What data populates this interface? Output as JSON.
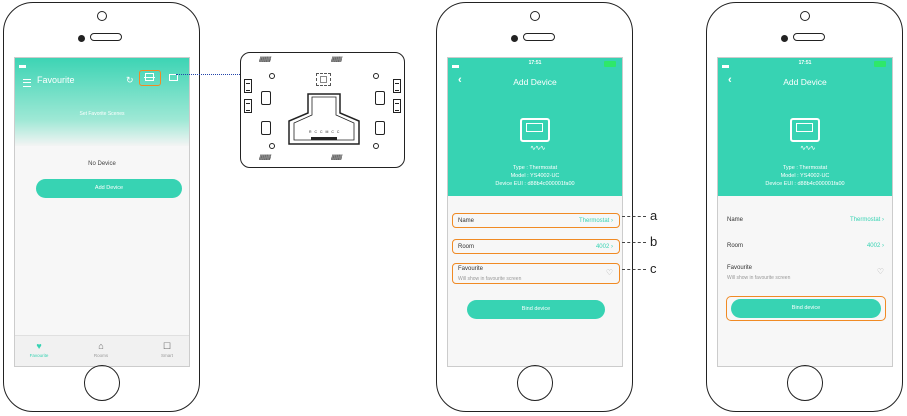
{
  "accent_color": "#37d3b3",
  "highlight_color": "#f08a24",
  "phone1": {
    "header_title": "Favourite",
    "scenes_text": "Set Favorite Scenes",
    "empty_text": "No Device",
    "add_button": "Add Device",
    "tabs": [
      {
        "label": "Favourite",
        "icon": "heart-icon"
      },
      {
        "label": "Rooms",
        "icon": "home-icon"
      },
      {
        "label": "Smart",
        "icon": "monitor-icon"
      }
    ]
  },
  "phone2": {
    "status_time": "17:51",
    "title": "Add Device",
    "type_line": "Type : Thermostat",
    "model_line": "Model : YS4002-UC",
    "eui_line": "Device EUI : d88b4c000001fa00",
    "name_label": "Name",
    "name_value": "Thermostat",
    "room_label": "Room",
    "room_value": "4002",
    "fav_label": "Favourite",
    "fav_sub": "Will show in favourite screen",
    "bind_button": "Bind device"
  },
  "phone3": {
    "status_time": "17:51",
    "title": "Add Device",
    "type_line": "Type : Thermostat",
    "model_line": "Model : YS4002-UC",
    "eui_line": "Device EUI : d88b4c000001fa00",
    "name_label": "Name",
    "name_value": "Thermostat",
    "room_label": "Room",
    "room_value": "4002",
    "fav_label": "Favourite",
    "fav_sub": "Will show in favourite screen",
    "bind_button": "Bind device"
  },
  "callouts": {
    "a": "a",
    "b": "b",
    "c": "c"
  },
  "device_label": "R C C M C C"
}
